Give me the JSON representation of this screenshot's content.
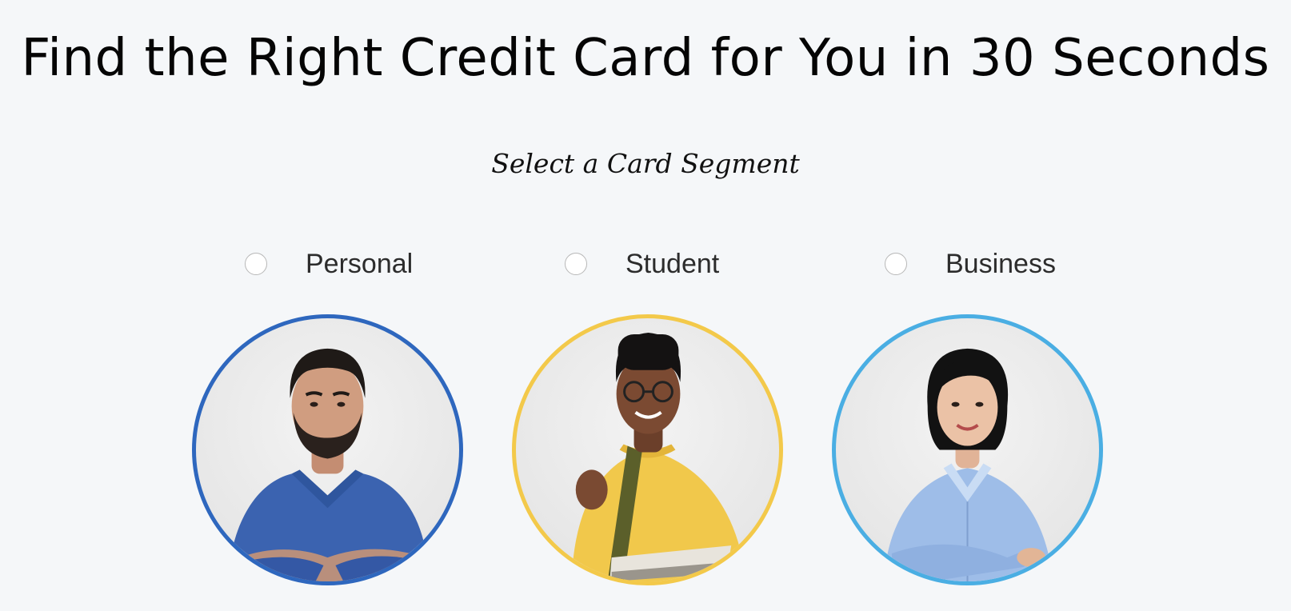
{
  "page": {
    "title": "Find the Right Credit Card for You in 30 Seconds",
    "subtitle": "Select a Card Segment"
  },
  "segments": [
    {
      "label": "Personal",
      "ring_color": "#2e67be",
      "selected": false,
      "icon": "man-blue-tshirt-portrait"
    },
    {
      "label": "Student",
      "ring_color": "#f3c94a",
      "selected": false,
      "icon": "student-yellow-sweater-portrait"
    },
    {
      "label": "Business",
      "ring_color": "#4aaee3",
      "selected": false,
      "icon": "woman-blue-shirt-portrait"
    }
  ]
}
